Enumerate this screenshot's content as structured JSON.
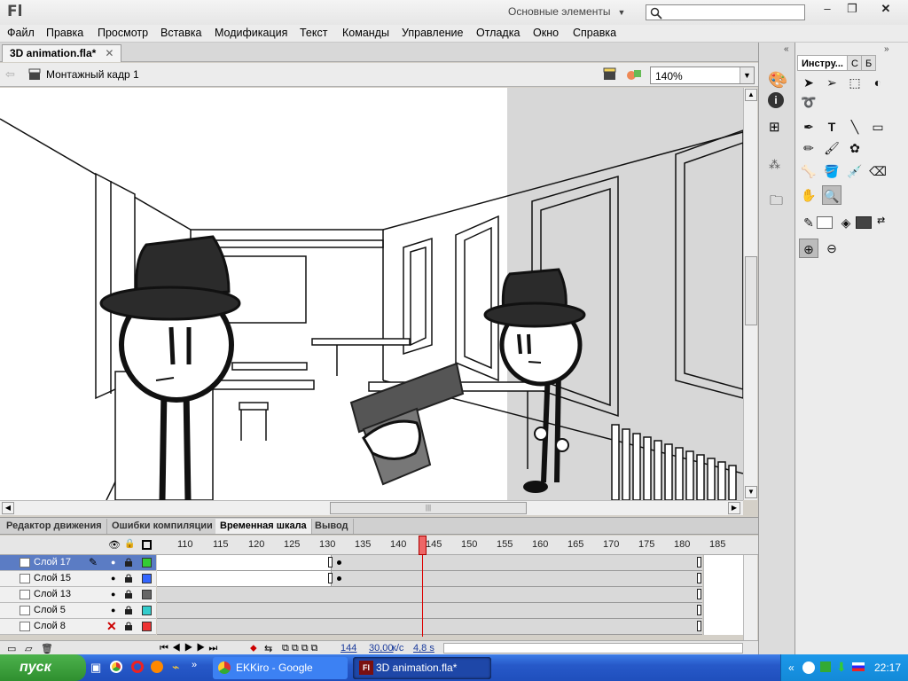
{
  "app": {
    "logo": "Fl",
    "workspace": "Основные элементы",
    "search_placeholder": ""
  },
  "menu": [
    "Файл",
    "Правка",
    "Просмотр",
    "Вставка",
    "Модификация",
    "Текст",
    "Команды",
    "Управление",
    "Отладка",
    "Окно",
    "Справка"
  ],
  "document": {
    "tab_title": "3D animation.fla*",
    "scene": "Монтажный кадр 1",
    "zoom": "140%"
  },
  "panels": {
    "tabs": [
      "Редактор движения",
      "Ошибки компиляции",
      "Временная шкала",
      "Вывод"
    ],
    "active_tab": "Временная шкала"
  },
  "timeline": {
    "frame_ticks": [
      "110",
      "115",
      "120",
      "125",
      "130",
      "135",
      "140",
      "145",
      "150",
      "155",
      "160",
      "165",
      "170",
      "175",
      "180",
      "185"
    ],
    "layers": [
      {
        "name": "Слой 17",
        "color": "#33cc33",
        "selected": true
      },
      {
        "name": "Слой 15",
        "color": "#3366ff",
        "selected": false
      },
      {
        "name": "Слой 13",
        "color": "#666666",
        "selected": false
      },
      {
        "name": "Слой 5",
        "color": "#33cccc",
        "selected": false
      },
      {
        "name": "Слой 8",
        "color": "#ee3333",
        "selected": false
      }
    ],
    "current_frame": "144",
    "fps": "30,00",
    "fps_unit": "к/с",
    "time": "4,8 s"
  },
  "tools_panel": {
    "tabs": [
      "Инстру...",
      "С",
      "Б"
    ]
  },
  "taskbar": {
    "start": "пуск",
    "tasks": [
      {
        "label": "EKKiro - Google Chrome",
        "active": false
      },
      {
        "label": "3D animation.fla*",
        "active": true
      }
    ],
    "clock": "22:17"
  }
}
